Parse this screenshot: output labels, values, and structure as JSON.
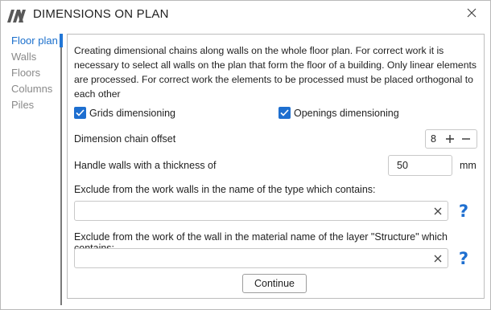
{
  "window": {
    "title": "DIMENSIONS ON PLAN"
  },
  "sidebar": {
    "items": [
      {
        "label": "Floor plan",
        "active": true
      },
      {
        "label": "Walls",
        "active": false
      },
      {
        "label": "Floors",
        "active": false
      },
      {
        "label": "Columns",
        "active": false
      },
      {
        "label": "Piles",
        "active": false
      }
    ]
  },
  "main": {
    "description": "Creating dimensional chains along walls on the whole floor plan. For correct work it is necessary to select all walls on the plan that form the floor of a building. Only linear elements are processed. For correct work the elements to be processed must be placed orthogonal to each other",
    "grids_checkbox": {
      "label": "Grids dimensioning",
      "checked": true
    },
    "openings_checkbox": {
      "label": "Openings dimensioning",
      "checked": true
    },
    "chain_offset": {
      "label": "Dimension chain offset",
      "value": "8"
    },
    "wall_thickness": {
      "label": "Handle walls with a thickness of",
      "value": "50",
      "unit": "mm"
    },
    "exclude_type": {
      "label": "Exclude from the work walls in the name of the type which contains:",
      "value": ""
    },
    "exclude_material": {
      "label": "Exclude from the work of the wall in the material name of the layer \"Structure\" which contains:",
      "value": ""
    },
    "continue_label": "Continue"
  },
  "colors": {
    "accent": "#1e6fd0",
    "active_nav": "#1a6fcc",
    "inactive_nav": "#8a8a8a"
  },
  "icons": [
    "app-logo-icon",
    "close-icon",
    "checkmark-icon",
    "plus-icon",
    "minus-icon",
    "clear-icon",
    "help-icon"
  ]
}
